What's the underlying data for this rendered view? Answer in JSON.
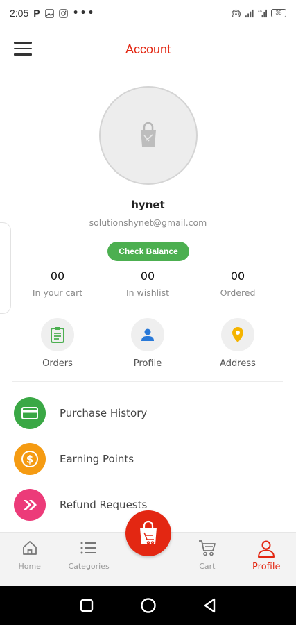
{
  "status_bar": {
    "time": "2:05",
    "p_label": "P",
    "battery": "38",
    "network": "4G"
  },
  "header": {
    "title": "Account",
    "menu_icon": "hamburger-icon"
  },
  "profile": {
    "name": "hynet",
    "email": "solutionshynet@gmail.com",
    "check_balance_label": "Check Balance"
  },
  "stats": [
    {
      "value": "00",
      "label": "In your cart"
    },
    {
      "value": "00",
      "label": "In wishlist"
    },
    {
      "value": "00",
      "label": "Ordered"
    }
  ],
  "quick_links": [
    {
      "label": "Orders",
      "icon": "clipboard-icon",
      "color": "#4caf50"
    },
    {
      "label": "Profile",
      "icon": "person-icon",
      "color": "#2979d8"
    },
    {
      "label": "Address",
      "icon": "location-pin-icon",
      "color": "#f5b400"
    }
  ],
  "menu": [
    {
      "label": "Purchase History",
      "icon": "credit-card-icon",
      "color": "#3aa845"
    },
    {
      "label": "Earning Points",
      "icon": "dollar-coin-icon",
      "color": "#f59b12"
    },
    {
      "label": "Refund Requests",
      "icon": "double-chevron-right-icon",
      "color": "#ec3b79"
    }
  ],
  "bottom_nav": [
    {
      "label": "Home",
      "icon": "home-icon"
    },
    {
      "label": "Categories",
      "icon": "list-icon"
    },
    {
      "label": "",
      "icon": "shopping-bag-icon"
    },
    {
      "label": "Cart",
      "icon": "cart-icon"
    },
    {
      "label": "Profile",
      "icon": "user-icon",
      "active": true
    }
  ],
  "colors": {
    "accent": "#e32712",
    "green": "#4caf50"
  }
}
